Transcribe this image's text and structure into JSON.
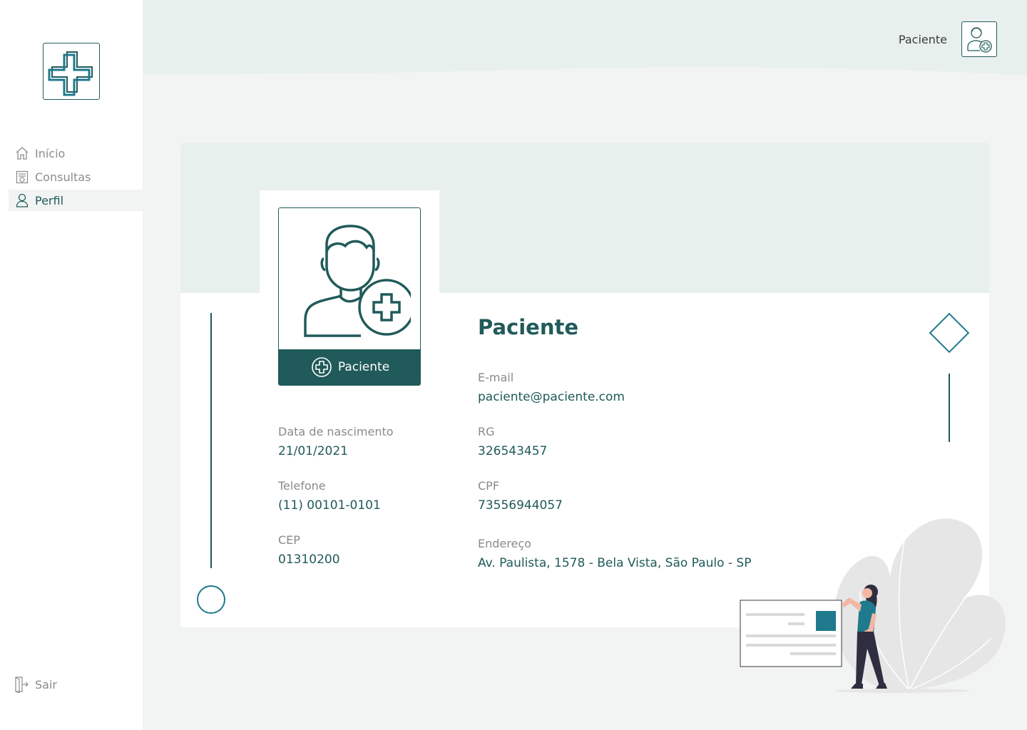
{
  "sidebar": {
    "logo_icon": "medical-cross-logo",
    "items": [
      {
        "label": "Início",
        "icon": "home-icon",
        "active": false
      },
      {
        "label": "Consultas",
        "icon": "clipboard-icon",
        "active": false
      },
      {
        "label": "Perfil",
        "icon": "user-icon",
        "active": true
      }
    ],
    "logout_label": "Sair"
  },
  "header": {
    "user_name": "Paciente",
    "avatar_icon": "patient-avatar-icon"
  },
  "profile": {
    "photo_icon": "patient-icon",
    "role_tag": "Paciente",
    "title": "Paciente",
    "fields": {
      "email": {
        "label": "E-mail",
        "value": "paciente@paciente.com"
      },
      "birth": {
        "label": "Data de nascimento",
        "value": "21/01/2021"
      },
      "rg": {
        "label": "RG",
        "value": "326543457"
      },
      "phone": {
        "label": "Telefone",
        "value": "(11) 00101-0101"
      },
      "cpf": {
        "label": "CPF",
        "value": "73556944057"
      },
      "cep": {
        "label": "CEP",
        "value": "01310200"
      },
      "address": {
        "label": "Endereço",
        "value": "Av. Paulista, 1578 - Bela Vista, São Paulo - SP"
      }
    }
  },
  "colors": {
    "primary": "#215a5a",
    "accent": "#1e7a8c",
    "banner": "#e8f0ee",
    "background": "#f2f4f3"
  }
}
